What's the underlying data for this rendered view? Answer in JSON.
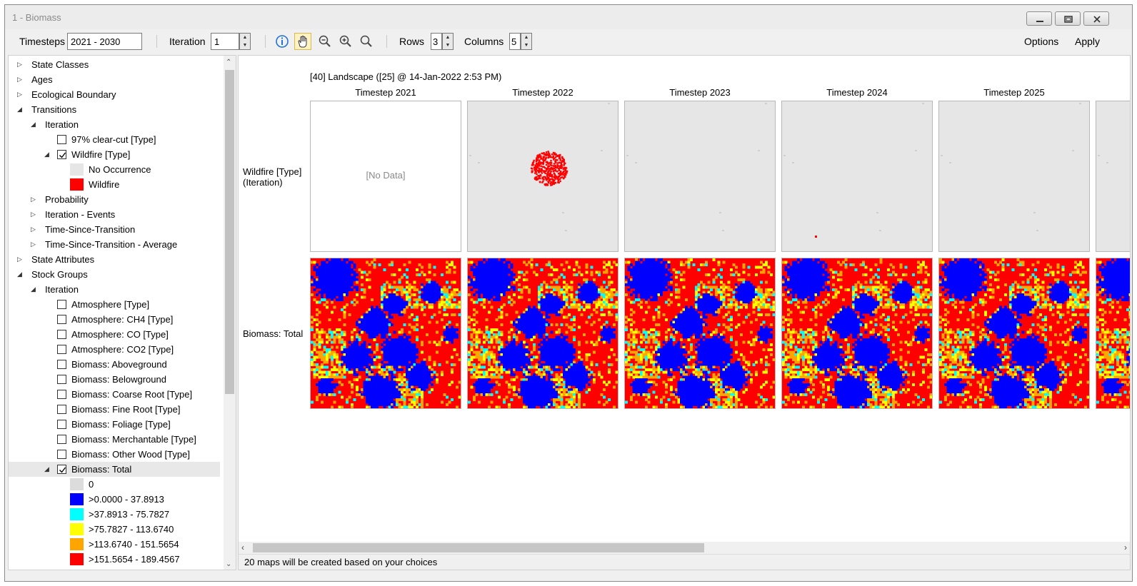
{
  "window": {
    "title": "1 - Biomass"
  },
  "toolbar": {
    "timesteps_label": "Timesteps",
    "timesteps_value": "2021 - 2030",
    "iteration_label": "Iteration",
    "iteration_value": "1",
    "rows_label": "Rows",
    "rows_value": "3",
    "columns_label": "Columns",
    "columns_value": "5",
    "options_label": "Options",
    "apply_label": "Apply",
    "icons": [
      "info-icon",
      "pan-hand-icon",
      "zoom-out-icon",
      "zoom-in-icon",
      "zoom-extent-icon"
    ]
  },
  "tree": [
    {
      "label": "State Classes",
      "level": 0,
      "expander": "collapsed"
    },
    {
      "label": "Ages",
      "level": 0,
      "expander": "collapsed"
    },
    {
      "label": "Ecological Boundary",
      "level": 0,
      "expander": "collapsed"
    },
    {
      "label": "Transitions",
      "level": 0,
      "expander": "expanded"
    },
    {
      "label": "Iteration",
      "level": 1,
      "expander": "expanded"
    },
    {
      "label": "97% clear-cut [Type]",
      "level": 2,
      "checkbox": false
    },
    {
      "label": "Wildfire [Type]",
      "level": 2,
      "checkbox": true,
      "expander": "expanded"
    },
    {
      "label": "No Occurrence",
      "level": 3,
      "swatch": "#e6e6e6"
    },
    {
      "label": "Wildfire",
      "level": 3,
      "swatch": "#ff0000"
    },
    {
      "label": "Probability",
      "level": 1,
      "expander": "collapsed"
    },
    {
      "label": "Iteration - Events",
      "level": 1,
      "expander": "collapsed"
    },
    {
      "label": "Time-Since-Transition",
      "level": 1,
      "expander": "collapsed"
    },
    {
      "label": "Time-Since-Transition - Average",
      "level": 1,
      "expander": "collapsed"
    },
    {
      "label": "State Attributes",
      "level": 0,
      "expander": "collapsed"
    },
    {
      "label": "Stock Groups",
      "level": 0,
      "expander": "expanded"
    },
    {
      "label": "Iteration",
      "level": 1,
      "expander": "expanded"
    },
    {
      "label": "Atmosphere [Type]",
      "level": 2,
      "checkbox": false
    },
    {
      "label": "Atmosphere: CH4 [Type]",
      "level": 2,
      "checkbox": false
    },
    {
      "label": "Atmosphere: CO [Type]",
      "level": 2,
      "checkbox": false
    },
    {
      "label": "Atmosphere: CO2 [Type]",
      "level": 2,
      "checkbox": false
    },
    {
      "label": "Biomass: Aboveground",
      "level": 2,
      "checkbox": false
    },
    {
      "label": "Biomass: Belowground",
      "level": 2,
      "checkbox": false
    },
    {
      "label": "Biomass: Coarse Root [Type]",
      "level": 2,
      "checkbox": false
    },
    {
      "label": "Biomass: Fine Root [Type]",
      "level": 2,
      "checkbox": false
    },
    {
      "label": "Biomass: Foliage [Type]",
      "level": 2,
      "checkbox": false
    },
    {
      "label": "Biomass: Merchantable [Type]",
      "level": 2,
      "checkbox": false
    },
    {
      "label": "Biomass: Other Wood [Type]",
      "level": 2,
      "checkbox": false
    },
    {
      "label": "Biomass: Total",
      "level": 2,
      "checkbox": true,
      "expander": "expanded",
      "selected": true
    },
    {
      "label": "0",
      "level": 3,
      "swatch": "#dcdcdc"
    },
    {
      "label": ">0.0000 - 37.8913",
      "level": 3,
      "swatch": "#0000ff"
    },
    {
      "label": ">37.8913 - 75.7827",
      "level": 3,
      "swatch": "#00ffff"
    },
    {
      "label": ">75.7827 - 113.6740",
      "level": 3,
      "swatch": "#ffff00"
    },
    {
      "label": ">113.6740 - 151.5654",
      "level": 3,
      "swatch": "#ffa500"
    },
    {
      "label": ">151.5654 - 189.4567",
      "level": 3,
      "swatch": "#ff0000"
    }
  ],
  "maps": {
    "header": "[40] Landscape ([25] @ 14-Jan-2022 2:53 PM)",
    "timesteps": [
      "Timestep 2021",
      "Timestep 2022",
      "Timestep 2023",
      "Timestep 2024",
      "Timestep 2025"
    ],
    "rows": [
      {
        "label_line1": "Wildfire [Type]",
        "label_line2": "(Iteration)"
      },
      {
        "label_line1": "Biomass: Total",
        "label_line2": ""
      }
    ],
    "no_data_text": "[No Data]",
    "colors": {
      "no_occurrence": "#e6e6e6",
      "wildfire": "#ff0000",
      "low": "#0000ff",
      "cyan": "#00ffff",
      "yellow": "#ffff00",
      "orange": "#ffa500",
      "high": "#ff0000"
    }
  },
  "status": {
    "text": "20 maps will be created based on your choices"
  }
}
